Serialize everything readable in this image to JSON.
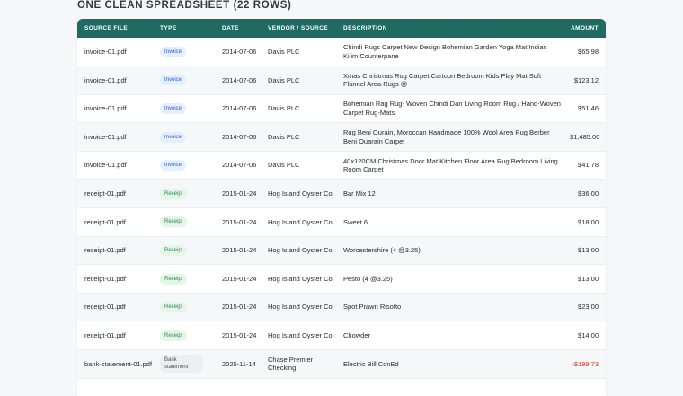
{
  "page": {
    "heading": "ONE CLEAN SPREADSHEET (22 ROWS)"
  },
  "columns": {
    "source_file": "SOURCE FILE",
    "type": "TYPE",
    "date": "DATE",
    "vendor": "VENDOR / SOURCE",
    "description": "DESCRIPTION",
    "amount": "AMOUNT"
  },
  "rows": [
    {
      "file": "invoice-01.pdf",
      "type": "Invoice",
      "kind": "invoice",
      "date": "2014-07-06",
      "vendor": "Davis PLC",
      "desc": "Chindi Rugs Carpet New Design Bohemian Garden Yoga Mat Indian Kilim Counterpane",
      "amount": "$65.98"
    },
    {
      "file": "invoice-01.pdf",
      "type": "Invoice",
      "kind": "invoice",
      "date": "2014-07-06",
      "vendor": "Davis PLC",
      "desc": "Xmas Christmas Rug Carpet Cartoon Bedroom Kids Play Mat Soft Flannel Area Rugs @",
      "amount": "$123.12"
    },
    {
      "file": "invoice-01.pdf",
      "type": "Invoice",
      "kind": "invoice",
      "date": "2014-07-06",
      "vendor": "Davis PLC",
      "desc": "Bohemian Rag Rug- Woven Chindi Dari Living Room Rug / Hand-Woven Carpet Rug-Mats",
      "amount": "$51.46"
    },
    {
      "file": "invoice-01.pdf",
      "type": "Invoice",
      "kind": "invoice",
      "date": "2014-07-06",
      "vendor": "Davis PLC",
      "desc": "Rug Beni Ourain, Moroccan Handmade 100% Wool Area Rug Berber Beni Ouarain Carpet",
      "amount": "$1,485.00"
    },
    {
      "file": "invoice-01.pdf",
      "type": "Invoice",
      "kind": "invoice",
      "date": "2014-07-06",
      "vendor": "Davis PLC",
      "desc": "40x120CM Christmas Door Mat Kitchen Floor Area Rug Bedroom Living Room Carpet",
      "amount": "$41.78"
    },
    {
      "file": "receipt-01.pdf",
      "type": "Receipt",
      "kind": "receipt",
      "date": "2015-01-24",
      "vendor": "Hog Island Oyster Co.",
      "desc": "Bar Mix 12",
      "amount": "$36.00"
    },
    {
      "file": "receipt-01.pdf",
      "type": "Receipt",
      "kind": "receipt",
      "date": "2015-01-24",
      "vendor": "Hog Island Oyster Co.",
      "desc": "Sweet 6",
      "amount": "$18.00"
    },
    {
      "file": "receipt-01.pdf",
      "type": "Receipt",
      "kind": "receipt",
      "date": "2015-01-24",
      "vendor": "Hog Island Oyster Co.",
      "desc": "Worcestershire (4 @3.25)",
      "amount": "$13.00"
    },
    {
      "file": "receipt-01.pdf",
      "type": "Receipt",
      "kind": "receipt",
      "date": "2015-01-24",
      "vendor": "Hog Island Oyster Co.",
      "desc": "Pesto (4 @3.25)",
      "amount": "$13.00"
    },
    {
      "file": "receipt-01.pdf",
      "type": "Receipt",
      "kind": "receipt",
      "date": "2015-01-24",
      "vendor": "Hog Island Oyster Co.",
      "desc": "Spot Prawn Risotto",
      "amount": "$23.00"
    },
    {
      "file": "receipt-01.pdf",
      "type": "Receipt",
      "kind": "receipt",
      "date": "2015-01-24",
      "vendor": "Hog Island Oyster Co.",
      "desc": "Chowder",
      "amount": "$14.00"
    },
    {
      "file": "bank-statement-01.pdf",
      "type": "Bank statement",
      "kind": "bank",
      "date": "2025-11-14",
      "vendor": "Chase Premier Checking",
      "desc": "Electric Bill ConEd",
      "amount": "-$199.73"
    }
  ],
  "colors": {
    "header_bg": "#1f6b61",
    "negative_amount": "#d23b2f",
    "invoice_badge": "#2a62c9",
    "receipt_badge": "#2f8a48"
  }
}
